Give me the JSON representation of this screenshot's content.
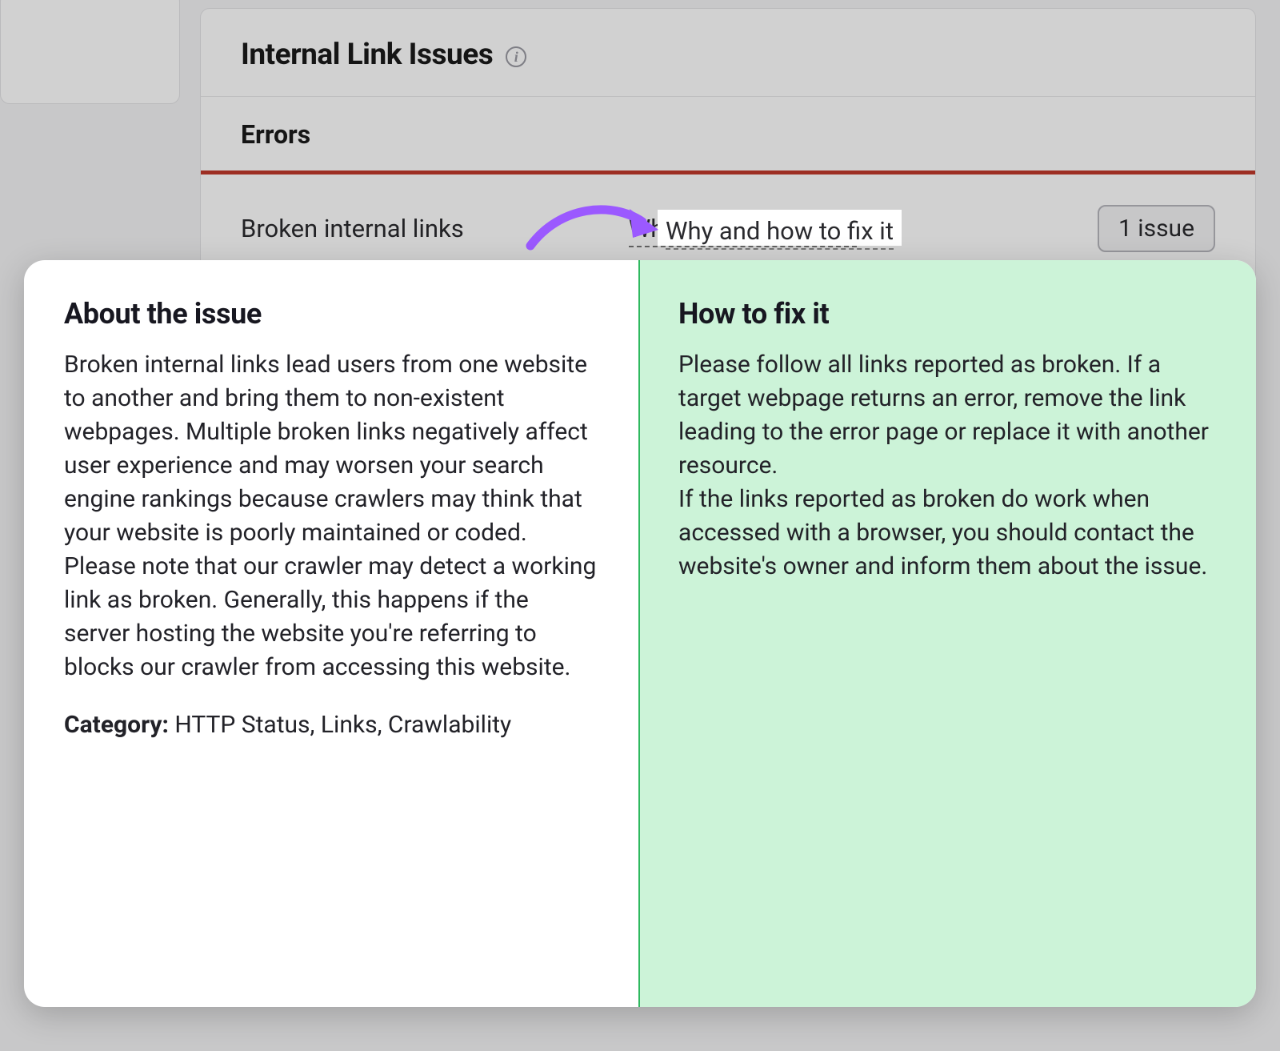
{
  "panel": {
    "title": "Internal Link Issues",
    "section": "Errors",
    "issue_name": "Broken internal links",
    "help_link": "Why and how to fix it",
    "badge": "1 issue"
  },
  "popup": {
    "about_title": "About the issue",
    "about_body_1": "Broken internal links lead users from one website to another and bring them to non-existent webpages. Multiple broken links negatively affect user experience and may worsen your search engine rankings because crawlers may think that your website is poorly maintained or coded.",
    "about_body_2": "Please note that our crawler may detect a working link as broken. Generally, this happens if the server hosting the website you're referring to blocks our crawler from accessing this website.",
    "category_label": "Category:",
    "category_value": "HTTP Status, Links, Crawlability",
    "fix_title": "How to fix it",
    "fix_body_1": "Please follow all links reported as broken. If a target webpage returns an error, remove the link leading to the error page or replace it with another resource.",
    "fix_body_2": "If the links reported as broken do work when accessed with a browser, you should contact the website's owner and inform them about the issue."
  }
}
